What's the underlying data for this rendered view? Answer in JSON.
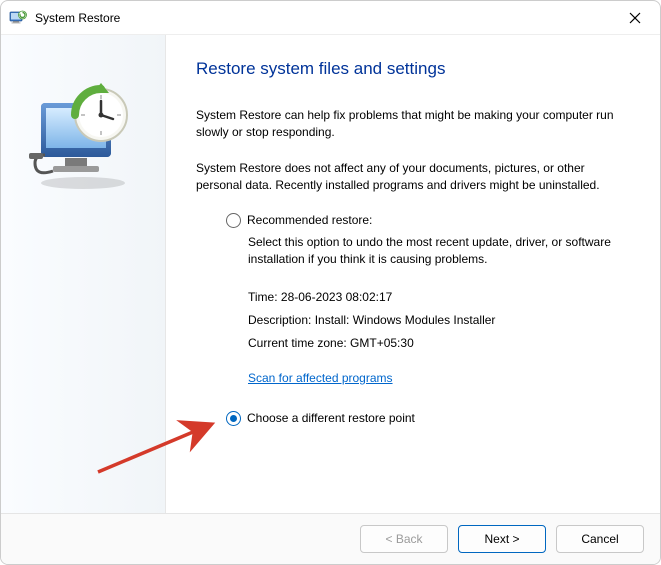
{
  "window": {
    "title": "System Restore"
  },
  "main": {
    "heading": "Restore system files and settings",
    "para1": "System Restore can help fix problems that might be making your computer run slowly or stop responding.",
    "para2": "System Restore does not affect any of your documents, pictures, or other personal data. Recently installed programs and drivers might be uninstalled."
  },
  "option_recommended": {
    "label": "Recommended restore:",
    "desc": "Select this option to undo the most recent update, driver, or software installation if you think it is causing problems.",
    "time": "Time: 28-06-2023 08:02:17",
    "description": "Description: Install: Windows Modules Installer",
    "timezone": "Current time zone: GMT+05:30",
    "scan_link": "Scan for affected programs"
  },
  "option_different": {
    "label": "Choose a different restore point"
  },
  "footer": {
    "back": "< Back",
    "next": "Next >",
    "cancel": "Cancel"
  }
}
